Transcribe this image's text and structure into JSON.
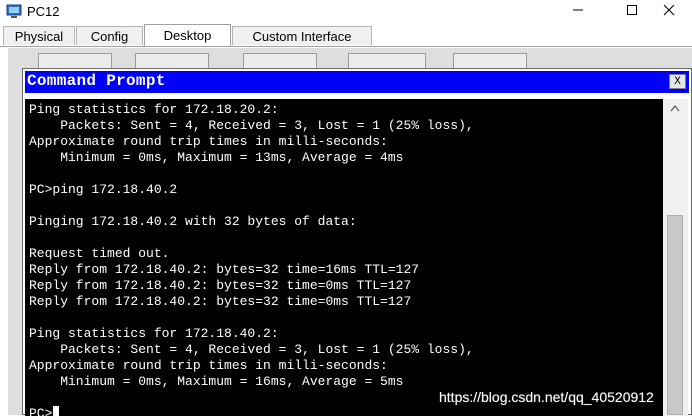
{
  "window": {
    "title": "PC12",
    "app_icon": "packet-tracer-pc-icon",
    "controls": [
      "minimize-icon",
      "maximize-icon",
      "close-icon"
    ]
  },
  "tabs": [
    {
      "label": "Physical",
      "active": false
    },
    {
      "label": "Config",
      "active": false
    },
    {
      "label": "Desktop",
      "active": true
    },
    {
      "label": "Custom Interface",
      "active": false
    }
  ],
  "command_prompt": {
    "title": "Command Prompt",
    "close_label": "X",
    "lines": [
      "Ping statistics for 172.18.20.2:",
      "    Packets: Sent = 4, Received = 3, Lost = 1 (25% loss),",
      "Approximate round trip times in milli-seconds:",
      "    Minimum = 0ms, Maximum = 13ms, Average = 4ms",
      "",
      "PC>ping 172.18.40.2",
      "",
      "Pinging 172.18.40.2 with 32 bytes of data:",
      "",
      "Request timed out.",
      "Reply from 172.18.40.2: bytes=32 time=16ms TTL=127",
      "Reply from 172.18.40.2: bytes=32 time=0ms TTL=127",
      "Reply from 172.18.40.2: bytes=32 time=0ms TTL=127",
      "",
      "Ping statistics for 172.18.40.2:",
      "    Packets: Sent = 4, Received = 3, Lost = 1 (25% loss),",
      "Approximate round trip times in milli-seconds:",
      "    Minimum = 0ms, Maximum = 16ms, Average = 5ms",
      "",
      "PC>"
    ]
  },
  "watermark": "https://blog.csdn.net/qq_40520912",
  "colors": {
    "cmd_title_bg": "#0000ff",
    "console_bg": "#000000",
    "console_text": "#ffffff"
  }
}
